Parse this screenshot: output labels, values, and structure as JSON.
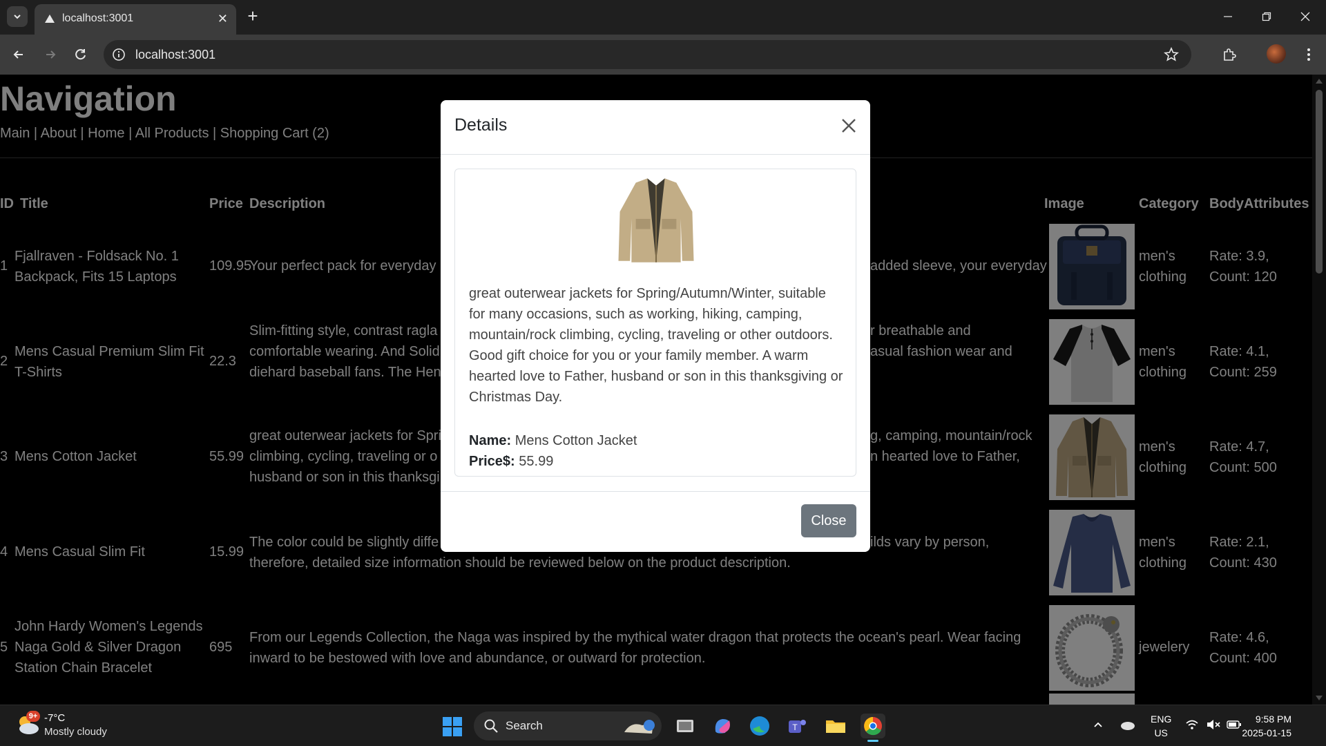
{
  "browser": {
    "tab_title": "localhost:3001",
    "url": "localhost:3001"
  },
  "page": {
    "heading": "Navigation",
    "nav_links": [
      "Main",
      "About",
      "Home",
      "All Products",
      "Shopping Cart (2)"
    ],
    "table": {
      "headers": {
        "id": "ID",
        "title": "Title",
        "price": "Price",
        "description": "Description",
        "image": "Image",
        "category": "Category",
        "body_attributes": "BodyAttributes"
      },
      "rows": [
        {
          "id": "1",
          "title": "Fjallraven - Foldsack No. 1 Backpack, Fits 15 Laptops",
          "price": "109.95",
          "description_left": "Your perfect pack for everyday u",
          "description_right": "added sleeve, your everyday",
          "category": "men's clothing",
          "rating": "Rate: 3.9, Count: 120",
          "image": "backpack"
        },
        {
          "id": "2",
          "title": "Mens Casual Premium Slim Fit T-Shirts",
          "price": "22.3",
          "description_left": "Slim-fitting style, contrast ragla\ncomfortable wearing. And Solid\ndiehard baseball fans. The Henl",
          "description_right": "r breathable and\nasual fashion wear and",
          "category": "men's clothing",
          "rating": "Rate: 4.1, Count: 259",
          "image": "t-shirt"
        },
        {
          "id": "3",
          "title": "Mens Cotton Jacket",
          "price": "55.99",
          "description_left": "great outerwear jackets for Spri\nclimbing, cycling, traveling or o\nhusband or son in this thanksgi",
          "description_right": "g, camping, mountain/rock\nn hearted love to Father,",
          "category": "men's clothing",
          "rating": "Rate: 4.7, Count: 500",
          "image": "jacket"
        },
        {
          "id": "4",
          "title": "Mens Casual Slim Fit",
          "price": "15.99",
          "description_left": "The color could be slightly diffe\ntherefore, detailed size information should be reviewed below on the product description.",
          "description_right": "ilds vary by person,",
          "category": "men's clothing",
          "rating": "Rate: 2.1, Count: 430",
          "image": "long-sleeve"
        },
        {
          "id": "5",
          "title": "John Hardy Women's Legends Naga Gold & Silver Dragon Station Chain Bracelet",
          "price": "695",
          "description_left": "From our Legends Collection, the Naga was inspired by the mythical water dragon that protects the ocean's pearl. Wear facing inward to be bestowed with love and abundance, or outward for protection.",
          "description_right": "",
          "category": "jewelery",
          "rating": "Rate: 4.6, Count: 400",
          "image": "bracelet"
        }
      ]
    }
  },
  "modal": {
    "title": "Details",
    "description": "great outerwear jackets for Spring/Autumn/Winter, suitable for many occasions, such as working, hiking, camping, mountain/rock climbing, cycling, traveling or other outdoors. Good gift choice for you or your family member. A warm hearted love to Father, husband or son in this thanksgiving or Christmas Day.",
    "name_label": "Name:",
    "name_value": "Mens Cotton Jacket",
    "price_label": "Price$:",
    "price_value": "55.99",
    "close_button": "Close",
    "image_icon": "jacket"
  },
  "taskbar": {
    "weather_badge": "9+",
    "temperature": "-7°C",
    "weather": "Mostly cloudy",
    "search_placeholder": "Search",
    "lang_top": "ENG",
    "lang_bottom": "US",
    "time": "9:58 PM",
    "date": "2025-01-15"
  },
  "colors": {
    "modal_button": "#6c757d",
    "page_bg": "#000000",
    "chrome_bg": "#3c3c3c"
  }
}
